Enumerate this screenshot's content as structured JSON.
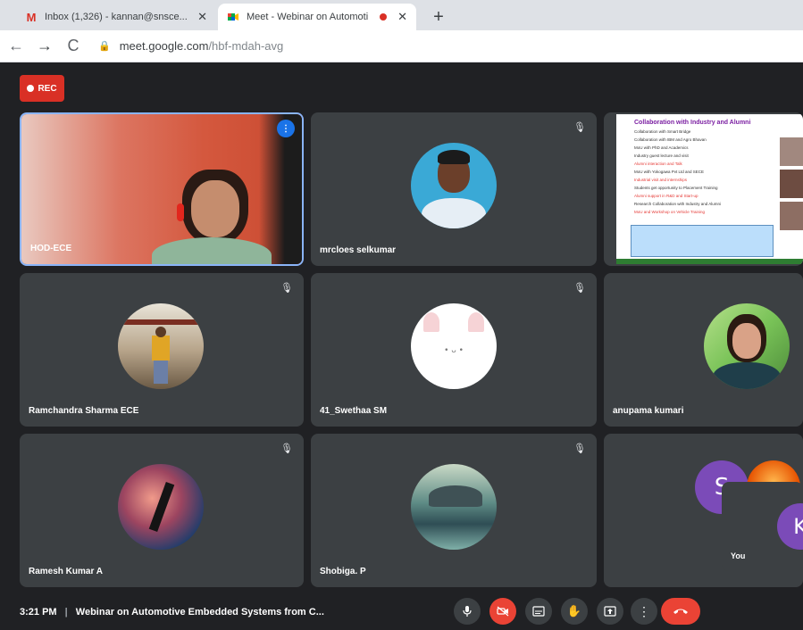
{
  "browser": {
    "tabs": [
      {
        "title": "Inbox (1,326) - kannan@snsce...",
        "favicon": "gmail-icon",
        "active": false
      },
      {
        "title": "Meet - Webinar on Automoti",
        "favicon": "meet-icon",
        "active": true,
        "recording": true
      }
    ],
    "new_tab": "+",
    "url_domain": "meet.google.com",
    "url_path": "/hbf-mdah-avg"
  },
  "meet": {
    "rec_label": "REC",
    "participants": [
      {
        "name": "HOD-ECE",
        "speaking": true
      },
      {
        "name": "mrcloes selkumar",
        "muted": true
      },
      {
        "name": "Ramchandra Sharma ECE",
        "muted": true
      },
      {
        "name": "41_Swethaa SM",
        "muted": true
      },
      {
        "name": "anupama kumari",
        "muted": false
      },
      {
        "name": "Ramesh Kumar A",
        "muted": true
      },
      {
        "name": "Shobiga. P",
        "muted": true
      }
    ],
    "overflow_initial": "S",
    "self": {
      "name": "You",
      "initial": "K"
    },
    "presentation": {
      "title": "Collaboration with Industry and Alumni",
      "lines": [
        "Collaboration with Smart Bridge",
        "Collaboration with IBM and Agro Bhavan",
        "MoU with PhD and Academics",
        "Industry guest lecture and visit",
        "Alumni interaction and Talk",
        "MoU with Yokogawa Pvt Ltd and SECE",
        "Industrial visit and internships",
        "Students get opportunity to Placement Training",
        "Alumni support in R&D and Start-up",
        "Research Collaboration with Industry and Alumni",
        "MoU and Workshop on Vehicle Training"
      ]
    },
    "bottom": {
      "time": "3:21 PM",
      "separator": "|",
      "meeting_title": "Webinar on Automotive Embedded Systems from C..."
    },
    "mic_muted_glyph": "🎙"
  }
}
